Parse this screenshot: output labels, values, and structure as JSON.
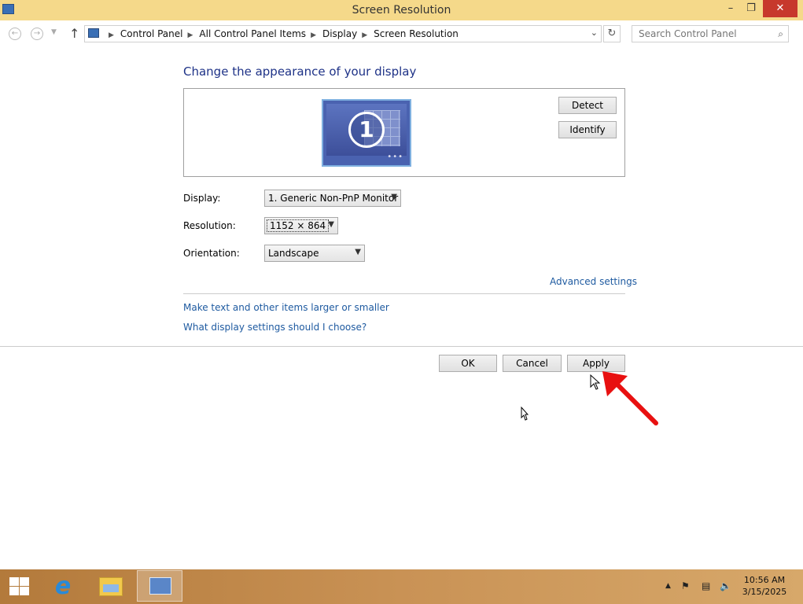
{
  "window": {
    "title": "Screen Resolution",
    "minimize_glyph": "–",
    "restore_glyph": "❐",
    "close_glyph": "✕"
  },
  "nav": {
    "breadcrumbs": [
      "Control Panel",
      "All Control Panel Items",
      "Display",
      "Screen Resolution"
    ],
    "search_placeholder": "Search Control Panel"
  },
  "main": {
    "heading": "Change the appearance of your display",
    "monitor_number": "1",
    "detect_label": "Detect",
    "identify_label": "Identify",
    "display_label": "Display:",
    "display_value": "1. Generic Non-PnP Monitor",
    "resolution_label": "Resolution:",
    "resolution_value": "1152 × 864",
    "orientation_label": "Orientation:",
    "orientation_value": "Landscape",
    "advanced_settings": "Advanced settings",
    "link_text_size": "Make text and other items larger or smaller",
    "link_help": "What display settings should I choose?"
  },
  "buttons": {
    "ok": "OK",
    "cancel": "Cancel",
    "apply": "Apply"
  },
  "taskbar": {
    "time": "10:56 AM",
    "date": "3/15/2025"
  },
  "icons": [
    "control-panel-icon",
    "back-icon",
    "forward-icon",
    "up-arrow-icon",
    "refresh-icon",
    "search-icon",
    "windows-start-icon",
    "internet-explorer-icon",
    "file-explorer-icon",
    "flag-icon",
    "network-icon",
    "volume-icon"
  ],
  "colors": {
    "titlebar": "#f5d98a",
    "close": "#c7382c",
    "link": "#1e5aa0",
    "heading": "#1e3287",
    "taskbar": "#c99255",
    "annotation": "#e81010"
  }
}
